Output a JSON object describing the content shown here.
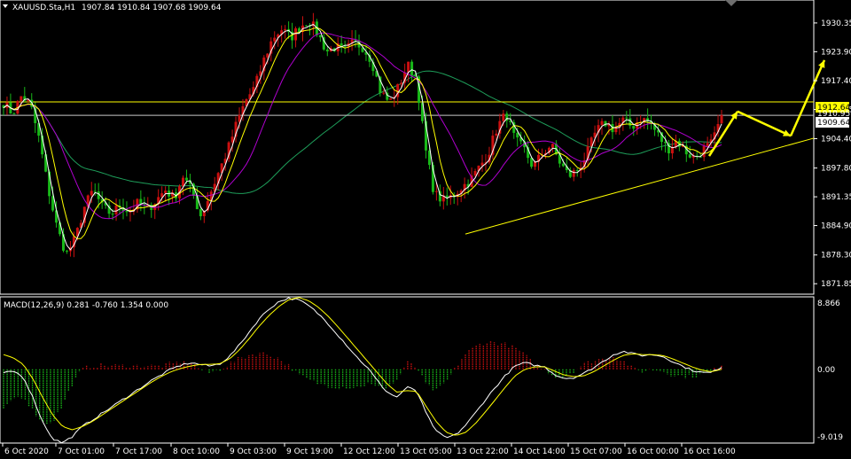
{
  "header": {
    "symbol": "XAUUSD.Sta,H1",
    "ohlc": "1907.84 1910.84 1907.68 1909.64"
  },
  "colors": {
    "background": "#000000",
    "grid": "#ffffff",
    "bull": "#cc1010",
    "bear": "#18b818",
    "ma_fast": "#ffffff",
    "ma_mid": "#ffff00",
    "ma_slow_purple": "#b000d0",
    "ma_long": "#1e9e5a",
    "hline": "#ffff00",
    "trendline": "#ffff00",
    "arrow": "#ffff00",
    "macd_line": "#ffffff",
    "signal_line": "#ffff00"
  },
  "price_axis": {
    "ticks": [
      "1930.35",
      "1923.90",
      "1917.40",
      "1910.95",
      "1904.40",
      "1897.80",
      "1891.35",
      "1884.90",
      "1878.30",
      "1871.85"
    ],
    "label_resistance": "1912.64",
    "label_current": "1909.64",
    "label_hidden": "1910.95"
  },
  "time_axis": {
    "labels": [
      "6 Oct 2020",
      "7 Oct 01:00",
      "7 Oct 17:00",
      "8 Oct 10:00",
      "9 Oct 03:00",
      "9 Oct 19:00",
      "12 Oct 12:00",
      "13 Oct 05:00",
      "13 Oct 22:00",
      "14 Oct 14:00",
      "15 Oct 07:00",
      "16 Oct 00:00",
      "16 Oct 16:00"
    ]
  },
  "macd": {
    "title": "MACD(12,26,9) 0.281 -0.760 1.354 0.000",
    "ticks": [
      "8.866",
      "0.00",
      "-9.019"
    ]
  },
  "chart_data": [
    {
      "type": "candlestick",
      "title": "XAUUSD.Sta,H1",
      "timeframe": "H1",
      "last_bar": {
        "open": 1907.84,
        "high": 1910.84,
        "low": 1907.68,
        "close": 1909.64
      },
      "ylim": [
        1869.5,
        1935.5
      ],
      "x_labels": [
        "6 Oct 2020",
        "7 Oct 01:00",
        "7 Oct 17:00",
        "8 Oct 10:00",
        "9 Oct 03:00",
        "9 Oct 19:00",
        "12 Oct 12:00",
        "13 Oct 05:00",
        "13 Oct 22:00",
        "14 Oct 14:00",
        "15 Oct 07:00",
        "16 Oct 00:00",
        "16 Oct 16:00"
      ],
      "close_path": [
        1912.5,
        1910.0,
        1914.0,
        1912.0,
        1904.0,
        1893.0,
        1884.0,
        1878.5,
        1882.0,
        1889.0,
        1893.0,
        1889.0,
        1887.5,
        1889.5,
        1888.0,
        1890.0,
        1888.5,
        1890.5,
        1893.0,
        1891.0,
        1896.0,
        1892.5,
        1887.0,
        1892.0,
        1897.0,
        1902.0,
        1908.0,
        1913.0,
        1916.0,
        1922.0,
        1927.0,
        1929.0,
        1927.0,
        1929.5,
        1931.0,
        1928.0,
        1924.0,
        1925.0,
        1924.0,
        1926.0,
        1925.0,
        1922.0,
        1915.0,
        1912.5,
        1916.0,
        1921.0,
        1918.0,
        1902.0,
        1892.0,
        1890.5,
        1891.5,
        1893.5,
        1895.0,
        1898.0,
        1901.0,
        1907.0,
        1910.0,
        1904.0,
        1902.0,
        1898.0,
        1901.0,
        1903.0,
        1899.0,
        1896.0,
        1897.5,
        1901.0,
        1906.0,
        1908.0,
        1906.5,
        1908.5,
        1907.0,
        1909.0,
        1908.0,
        1905.0,
        1902.0,
        1904.0,
        1901.5,
        1900.0,
        1902.0,
        1903.5,
        1909.64
      ],
      "close_path_note_unit": "USD per troy ounce",
      "horizontal_levels": [
        1912.64,
        1909.64
      ],
      "trendline": {
        "from": {
          "x": "13 Oct 22:00",
          "y": 1883.0
        },
        "to": {
          "x": "16 Oct 16:00 +",
          "y": 1904.5
        }
      },
      "projection_arrows": [
        {
          "from": 1900.5,
          "to": 1910.5
        },
        {
          "from": 1910.5,
          "to": 1905.0
        },
        {
          "from": 1905.0,
          "to": 1922.0
        }
      ]
    },
    {
      "type": "histogram",
      "title": "MACD(12,26,9) 0.281 -0.760 1.354 0.000",
      "ylim": [
        -9.019,
        8.866
      ],
      "macd_path": [
        -0.5,
        -0.2,
        -0.9,
        -3.5,
        -6.5,
        -8.5,
        -9.0,
        -8.2,
        -7.0,
        -6.2,
        -5.4,
        -4.6,
        -3.8,
        -3.0,
        -2.2,
        -1.4,
        -0.7,
        0.0,
        0.5,
        0.8,
        0.6,
        0.4,
        0.7,
        1.6,
        3.0,
        4.6,
        6.2,
        7.4,
        8.3,
        8.7,
        8.5,
        7.8,
        6.8,
        5.6,
        4.2,
        2.8,
        1.4,
        0.2,
        -1.4,
        -2.8,
        -3.4,
        -2.2,
        -2.6,
        -5.5,
        -7.6,
        -8.4,
        -8.0,
        -6.8,
        -5.3,
        -3.7,
        -2.2,
        -0.8,
        0.4,
        0.8,
        0.5,
        0.3,
        -0.6,
        -1.1,
        -1.0,
        -0.5,
        0.2,
        1.0,
        1.8,
        2.2,
        1.9,
        1.7,
        1.8,
        1.6,
        1.0,
        0.4,
        -0.1,
        -0.4,
        -0.4,
        0.3
      ],
      "signal_path": [
        1.8,
        1.4,
        0.6,
        -1.2,
        -3.5,
        -5.6,
        -7.0,
        -7.4,
        -7.0,
        -6.4,
        -5.6,
        -4.8,
        -4.0,
        -3.2,
        -2.4,
        -1.6,
        -0.9,
        -0.3,
        0.1,
        0.4,
        0.6,
        0.6,
        0.7,
        1.3,
        2.4,
        3.8,
        5.3,
        6.6,
        7.7,
        8.5,
        8.8,
        8.4,
        7.6,
        6.5,
        5.2,
        3.8,
        2.4,
        1.0,
        -0.4,
        -1.8,
        -2.8,
        -2.6,
        -2.7,
        -4.6,
        -6.4,
        -7.7,
        -8.1,
        -7.7,
        -6.6,
        -5.2,
        -3.7,
        -2.2,
        -0.8,
        0.0,
        0.3,
        0.3,
        -0.2,
        -0.7,
        -0.9,
        -0.8,
        -0.3,
        0.4,
        1.1,
        1.7,
        1.9,
        1.8,
        1.8,
        1.7,
        1.3,
        0.8,
        0.3,
        -0.1,
        -0.3,
        0.0
      ]
    }
  ]
}
